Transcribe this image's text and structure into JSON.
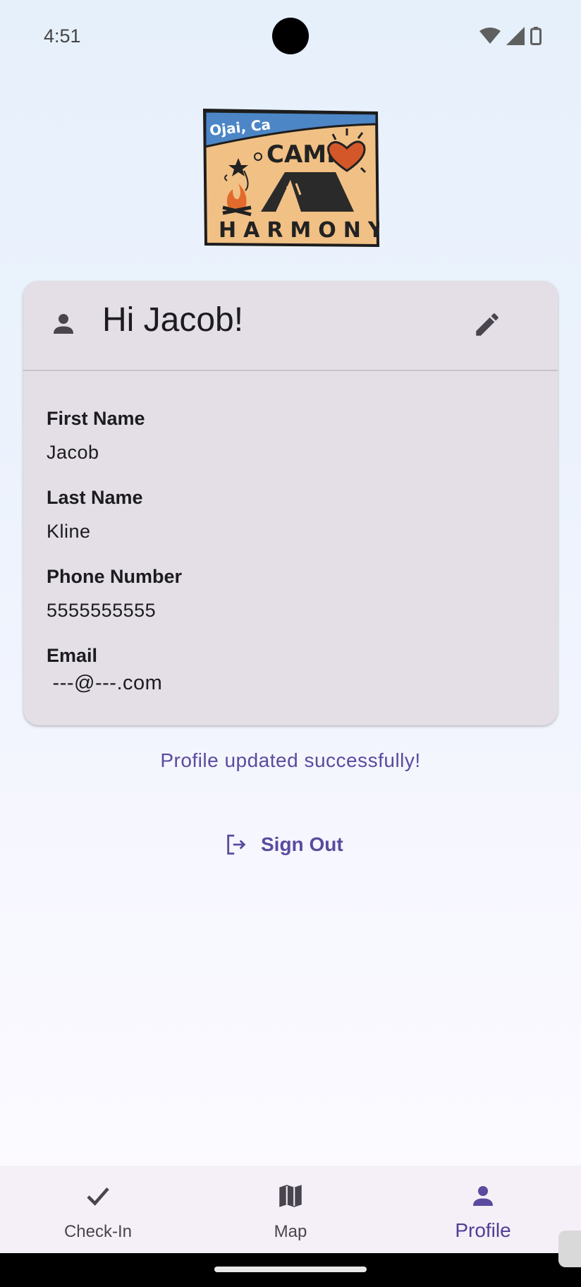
{
  "status_bar": {
    "time": "4:51"
  },
  "logo": {
    "alt": "Camp Harmony logo",
    "text_top": "Ojai, Ca",
    "text_camp": "CAMP",
    "text_harmony": "HARMONY"
  },
  "profile_card": {
    "greeting": "Hi Jacob!",
    "fields": [
      {
        "label": "First Name",
        "value": "Jacob"
      },
      {
        "label": "Last Name",
        "value": "Kline"
      },
      {
        "label": "Phone Number",
        "value": "5555555555"
      },
      {
        "label": "Email",
        "value": " ---@---.com"
      }
    ]
  },
  "status_message": "Profile updated successfully!",
  "sign_out": {
    "label": "Sign Out"
  },
  "bottom_nav": {
    "items": [
      {
        "label": "Check-In",
        "icon": "check-icon",
        "active": false
      },
      {
        "label": "Map",
        "icon": "map-icon",
        "active": false
      },
      {
        "label": "Profile",
        "icon": "person-icon",
        "active": true
      }
    ]
  },
  "colors": {
    "accent": "#5a4b9e",
    "card_background": "#e4dfe6",
    "nav_background": "#f5eff7"
  }
}
